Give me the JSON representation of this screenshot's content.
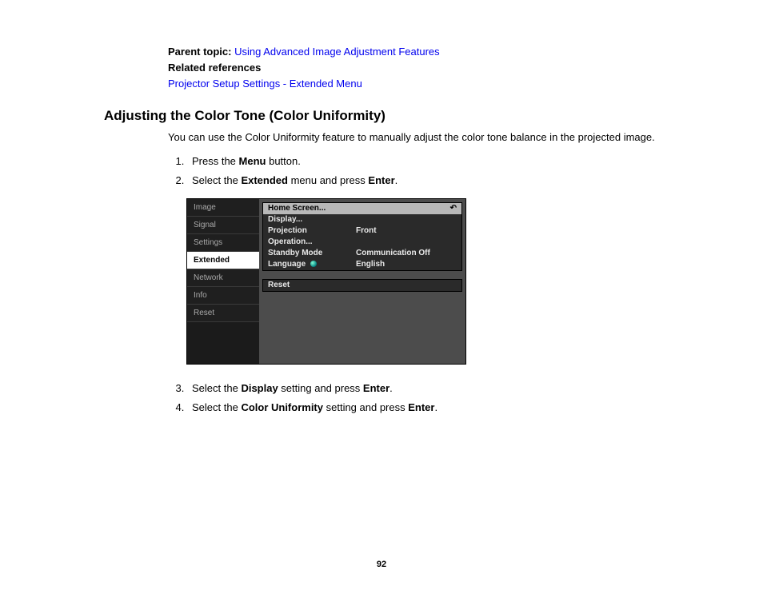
{
  "meta": {
    "parent_topic_label": "Parent topic:",
    "parent_topic_link": "Using Advanced Image Adjustment Features",
    "related_label": "Related references",
    "related_link": "Projector Setup Settings - Extended Menu"
  },
  "section_title": "Adjusting the Color Tone (Color Uniformity)",
  "intro": "You can use the Color Uniformity feature to manually adjust the color tone balance in the projected image.",
  "steps": {
    "s1a": "Press the ",
    "s1b": "Menu",
    "s1c": " button.",
    "s2a": "Select the ",
    "s2b": "Extended",
    "s2c": " menu and press ",
    "s2d": "Enter",
    "s2e": ".",
    "s3a": "Select the ",
    "s3b": "Display",
    "s3c": " setting and press ",
    "s3d": "Enter",
    "s3e": ".",
    "s4a": "Select the ",
    "s4b": "Color Uniformity",
    "s4c": " setting and press ",
    "s4d": "Enter",
    "s4e": "."
  },
  "osd": {
    "nav": [
      "Image",
      "Signal",
      "Settings",
      "Extended",
      "Network",
      "Info",
      "Reset"
    ],
    "nav_selected": "Extended",
    "rows": [
      {
        "label": "Home Screen...",
        "value": "",
        "highlight": true,
        "return": true
      },
      {
        "label": "Display...",
        "value": ""
      },
      {
        "label": "Projection",
        "value": "Front"
      },
      {
        "label": "Operation...",
        "value": ""
      },
      {
        "label": "Standby Mode",
        "value": "Communication Off"
      },
      {
        "label": "Language",
        "value": "English",
        "lang_icon": true
      }
    ],
    "reset_label": "Reset"
  },
  "page_number": "92"
}
